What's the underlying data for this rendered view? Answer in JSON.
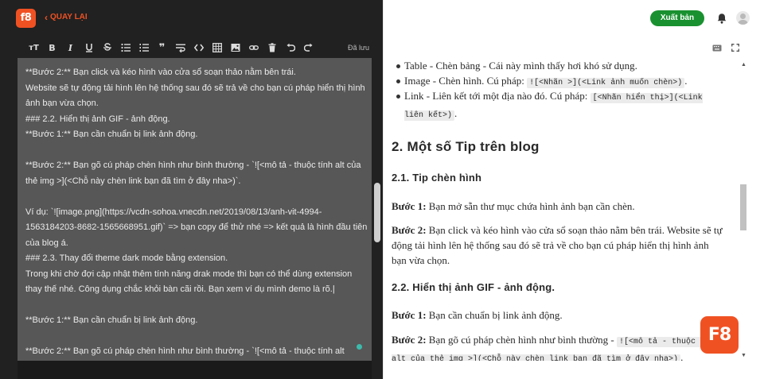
{
  "header": {
    "logo_text": "f8",
    "back_label": "QUAY LẠI",
    "publish_label": "Xuất bản",
    "saved_status": "Đã lưu"
  },
  "toolbar": {
    "items": [
      "heading-icon",
      "bold-icon",
      "italic-icon",
      "underline-icon",
      "strikethrough-icon",
      "unordered-list-icon",
      "ordered-list-icon",
      "quote-icon",
      "wrap-icon",
      "code-icon",
      "table-icon",
      "image-icon",
      "link-icon",
      "delete-icon",
      "undo-icon",
      "redo-icon"
    ],
    "heading_label": "ᴛT",
    "bold_label": "B",
    "italic_label": "I",
    "quote_label": "❞"
  },
  "editor": {
    "content": "**Bước 2:** Bạn click và kéo hình vào cửa sổ soạn thảo nằm bên trái.\nWebsite sẽ tự động tải hình lên hệ thống sau đó sẽ trả về cho bạn cú pháp hiển thị hình ảnh bạn vừa chọn.\n### 2.2. Hiển thị ảnh GIF - ảnh động.\n**Bước 1:** Bạn cần chuẩn bị link ảnh động.\n\n**Bước 2:** Bạn gõ cú pháp chèn hình như bình thường - `![<mô tả - thuộc tính alt của thẻ img >](<Chỗ này chèn link bạn đã tìm ở đây nha>)`.\n\nVí dụ: `![image.png](https://vcdn-sohoa.vnecdn.net/2019/08/13/anh-vit-4994-1563184203-8682-1565668951.gif)` => bạn copy để thử nhé => kết quả là hình đầu tiên của blog á.\n### 2.3. Thay đổi theme dark mode bằng extension.\nTrong khi chờ đợi cập nhật thêm tính năng drak mode thì bạn có thể dùng extension thay thế nhé. Công dụng chắc khỏi bàn cãi rồi. Bạn xem ví dụ mình demo là rõ.|\n\n**Bước 1:** Bạn cần chuẩn bị link ảnh động.\n\n**Bước 2:** Bạn gõ cú pháp chèn hình như bình thường - `![<mô tả - thuộc tính alt"
  },
  "preview": {
    "list": [
      {
        "text": "Table - Chèn bảng - Cái này mình thấy hơi khó sử dụng.",
        "code": ""
      },
      {
        "text": "Image - Chèn hình. Cú pháp: ",
        "code": "![<Nhãn >](<Link ảnh muốn chèn>)",
        "after": "."
      },
      {
        "text": "Link - Liên kết tới một địa nào đó. Cú pháp: ",
        "code": "[<Nhãn hiển thị>](<Link liên kết>)",
        "after": "."
      }
    ],
    "h2": "2. Một số Tip trên blog",
    "h3_1": "2.1. Tip chèn hình",
    "p1_bold": "Bước 1:",
    "p1_text": " Bạn mở sẵn thư mục chứa hình ảnh bạn cần chèn.",
    "p2_bold": "Bước 2:",
    "p2_text": " Bạn click và kéo hình vào cửa sổ soạn thảo nằm bên trái. Website sẽ tự động tải hình lên hệ thống sau đó sẽ trả về cho bạn cú pháp hiển thị hình ảnh bạn vừa chọn.",
    "h3_2": "2.2. Hiển thị ảnh GIF - ảnh động.",
    "p3_bold": "Bước 1:",
    "p3_text": " Bạn cần chuẩn bị link ảnh động.",
    "p4_bold": "Bước 2:",
    "p4_text": " Bạn gõ cú pháp chèn hình như bình thường - ",
    "p4_code": "![<mô tả - thuộc tính alt của thẻ img >](<Chỗ này chèn link bạn đã tìm ở đây nha>)",
    "p4_after": "."
  },
  "badge": {
    "text": "F8"
  },
  "colors": {
    "brand": "#f05123",
    "publish": "#1a9130",
    "editor_bg": "#575757",
    "dark_bg": "#212121"
  }
}
